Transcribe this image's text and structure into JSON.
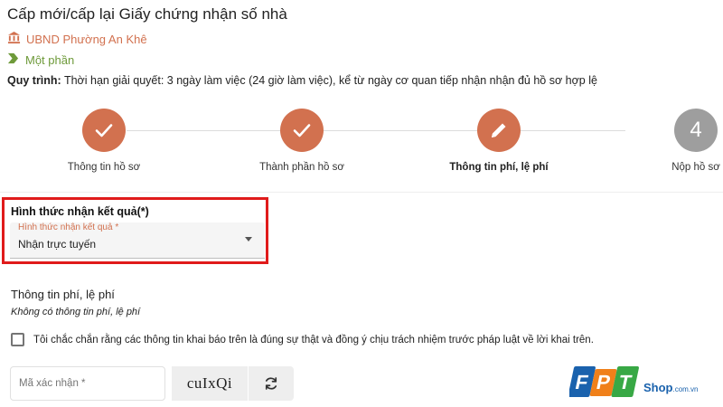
{
  "page": {
    "title": "Cấp mới/cấp lại Giấy chứng nhận số nhà",
    "agency": "UBND Phường An Khê",
    "service_level": "Một phần",
    "process_label": "Quy trình:",
    "process_text": " Thời hạn giải quyết: 3 ngày làm việc (24 giờ làm việc), kể từ ngày cơ quan tiếp nhận nhận đủ hồ sơ hợp lệ"
  },
  "stepper": {
    "steps": [
      {
        "label": "Thông tin hồ sơ",
        "state": "done",
        "icon": "check-icon"
      },
      {
        "label": "Thành phần hồ sơ",
        "state": "done",
        "icon": "check-icon"
      },
      {
        "label": "Thông tin phí, lệ phí",
        "state": "active",
        "icon": "pencil-icon"
      },
      {
        "label": "Nộp hồ sơ",
        "state": "pending",
        "number": "4"
      }
    ]
  },
  "result_form": {
    "heading": "Hình thức nhận kết quả(*)",
    "select_label": "Hình thức nhận kết quả *",
    "select_value": "Nhận trực tuyến"
  },
  "fees": {
    "heading": "Thông tin phí, lệ phí",
    "empty_text": "Không có thông tin phí, lệ phí"
  },
  "agreement": {
    "checked": false,
    "text": "Tôi chắc chắn rằng các thông tin khai báo trên là đúng sự thật và đồng ý chịu trách nhiệm trước pháp luật về lời khai trên."
  },
  "captcha": {
    "placeholder": "Mã xác nhận *",
    "code": "cuIxQi"
  },
  "watermark": {
    "brand": "FPT",
    "suffix": "Shop",
    "domain": ".com.vn"
  },
  "colors": {
    "accent": "#d2714f",
    "level": "#6e9a3a",
    "pending": "#9e9e9e",
    "highlight": "#e01b1b"
  }
}
